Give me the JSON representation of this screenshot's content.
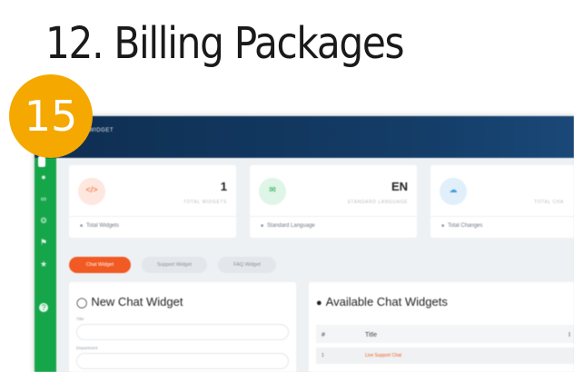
{
  "slide": {
    "title": "12. Billing Packages",
    "step_number": "15"
  },
  "colors": {
    "badge": "#f5a800",
    "sidebar": "#16a64a",
    "topbar": "#0f2f52",
    "accent": "#f15a22"
  },
  "app": {
    "header_title": "WIDGET",
    "sidebar_icons": [
      "user-icon",
      "link-icon",
      "settings-icon",
      "tag-icon",
      "star-icon",
      "help-icon"
    ],
    "stats": [
      {
        "icon": "code-icon",
        "value": "1",
        "label": "TOTAL WIDGETS",
        "footer_icon": "widgets-icon",
        "footer": "Total Widgets",
        "color": "#f15a22"
      },
      {
        "icon": "chat-icon",
        "value": "EN",
        "label": "STANDARD LANGUAGE",
        "footer_icon": "language-icon",
        "footer": "Standard Language",
        "color": "#18a94d"
      },
      {
        "icon": "cloud-icon",
        "value": "",
        "label": "TOTAL CHA",
        "footer_icon": "changes-icon",
        "footer": "Total Changes",
        "color": "#3a9bdc"
      }
    ],
    "tabs": [
      "Chat Widget",
      "Support Widget",
      "FAQ Widget"
    ],
    "new_widget": {
      "title": "New Chat Widget",
      "field_title": "Title",
      "field_department": "Department"
    },
    "available": {
      "title": "Available Chat Widgets",
      "columns": [
        "#",
        "Title",
        "I"
      ],
      "rows": [
        {
          "num": "1",
          "title": "Live Support Chat"
        }
      ]
    }
  }
}
